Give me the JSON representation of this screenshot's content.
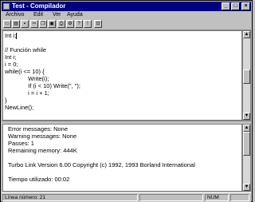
{
  "window": {
    "title": "Test - Compilador",
    "controls": [
      "_",
      "□",
      "×"
    ]
  },
  "menu": [
    "Archivo",
    "Edit",
    "Ver",
    "Ayuda"
  ],
  "toolbar": {
    "buttons": [
      {
        "name": "new-file-icon",
        "glyph": "▭"
      },
      {
        "name": "open-file-icon",
        "glyph": "▤"
      },
      {
        "name": "save-file-icon",
        "glyph": "▪"
      },
      {
        "name": "cut-icon",
        "glyph": "✂"
      },
      {
        "name": "copy-icon",
        "glyph": "❐"
      },
      {
        "name": "paste-icon",
        "glyph": "▣"
      },
      {
        "name": "print-icon",
        "glyph": "⎙"
      },
      {
        "name": "run-icon",
        "glyph": "⚙"
      },
      {
        "name": "help-icon",
        "glyph": "?"
      },
      {
        "name": "stop-icon",
        "glyph": "!"
      },
      {
        "name": "exit-icon",
        "glyph": "⊡"
      }
    ]
  },
  "editor": {
    "lines": [
      "Int i;",
      "",
      "// Función while",
      "Int i;",
      "i = 0;",
      "while(i <= 10) {",
      "              Write(i);",
      "              If (i < 10) Write(\", \");",
      "              i = i + 1;",
      "}",
      "NewLine();"
    ]
  },
  "output": {
    "lines": [
      "Error messages:   None",
      "Warning messages:  None",
      "Passes:           1",
      "Remaining memory:  444K",
      "",
      "Turbo Link  Version 6.00 Copyright (c) 1992, 1993 Borland International",
      "",
      "Tiempo utilizado: 00:02"
    ]
  },
  "status": {
    "position": "Línea número: 21",
    "empty": "",
    "num": "NUM",
    "caps": ""
  }
}
